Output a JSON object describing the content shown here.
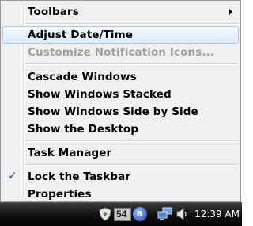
{
  "menu": {
    "toolbars": "Toolbars",
    "adjust_date_time": "Adjust Date/Time",
    "customize_notification_icons": "Customize Notification Icons...",
    "cascade_windows": "Cascade Windows",
    "show_windows_stacked": "Show Windows Stacked",
    "show_windows_side_by_side": "Show Windows Side by Side",
    "show_the_desktop": "Show the Desktop",
    "task_manager": "Task Manager",
    "lock_the_taskbar": "Lock the Taskbar",
    "properties": "Properties",
    "lock_the_taskbar_checked": true,
    "check_glyph": "✓"
  },
  "taskbar": {
    "tray_badge_number": "54",
    "tray_letter": "a",
    "clock": "12:39 AM",
    "icons": [
      "shield-icon",
      "counter-badge-icon",
      "circle-a-icon",
      "network-icon",
      "volume-icon"
    ]
  },
  "colors": {
    "menu_bg": "#f0f0f0",
    "hover_border": "#a8cbf1",
    "disabled_text": "#a0a0a0",
    "taskbar_bg": "#0f0f0f"
  }
}
